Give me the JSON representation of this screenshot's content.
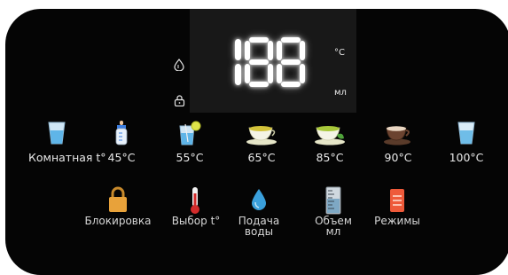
{
  "display": {
    "digits": "188",
    "unit_top": "°C",
    "unit_bottom": "мл",
    "side_icons": [
      "water-drop-outline-icon",
      "lock-outline-icon"
    ]
  },
  "temperatures": [
    {
      "label": "Комнатная t°",
      "icon": "glass-icon"
    },
    {
      "label": "45°C",
      "icon": "baby-bottle-icon"
    },
    {
      "label": "55°C",
      "icon": "lemon-water-icon"
    },
    {
      "label": "65°C",
      "icon": "tea-cup-icon"
    },
    {
      "label": "85°C",
      "icon": "green-tea-icon"
    },
    {
      "label": "90°C",
      "icon": "coffee-cup-icon"
    },
    {
      "label": "100°C",
      "icon": "hot-glass-icon"
    }
  ],
  "controls": [
    {
      "label": "Блокировка",
      "icon": "padlock-icon"
    },
    {
      "label": "Выбор t°",
      "icon": "thermometer-icon"
    },
    {
      "label": "Подача\nводы",
      "line1": "Подача",
      "line2": "воды",
      "icon": "water-drop-icon"
    },
    {
      "label": "Объем\nмл",
      "line1": "Объем",
      "line2": "мл",
      "icon": "measuring-cup-icon"
    },
    {
      "label": "Режимы",
      "icon": "modes-icon"
    }
  ],
  "colors": {
    "panel": "#050505",
    "display": "#181818",
    "padlock": "#e8a23a",
    "thermometer": "#d22b2b",
    "drop": "#3aa0dc",
    "modes": "#ee5a3a"
  }
}
